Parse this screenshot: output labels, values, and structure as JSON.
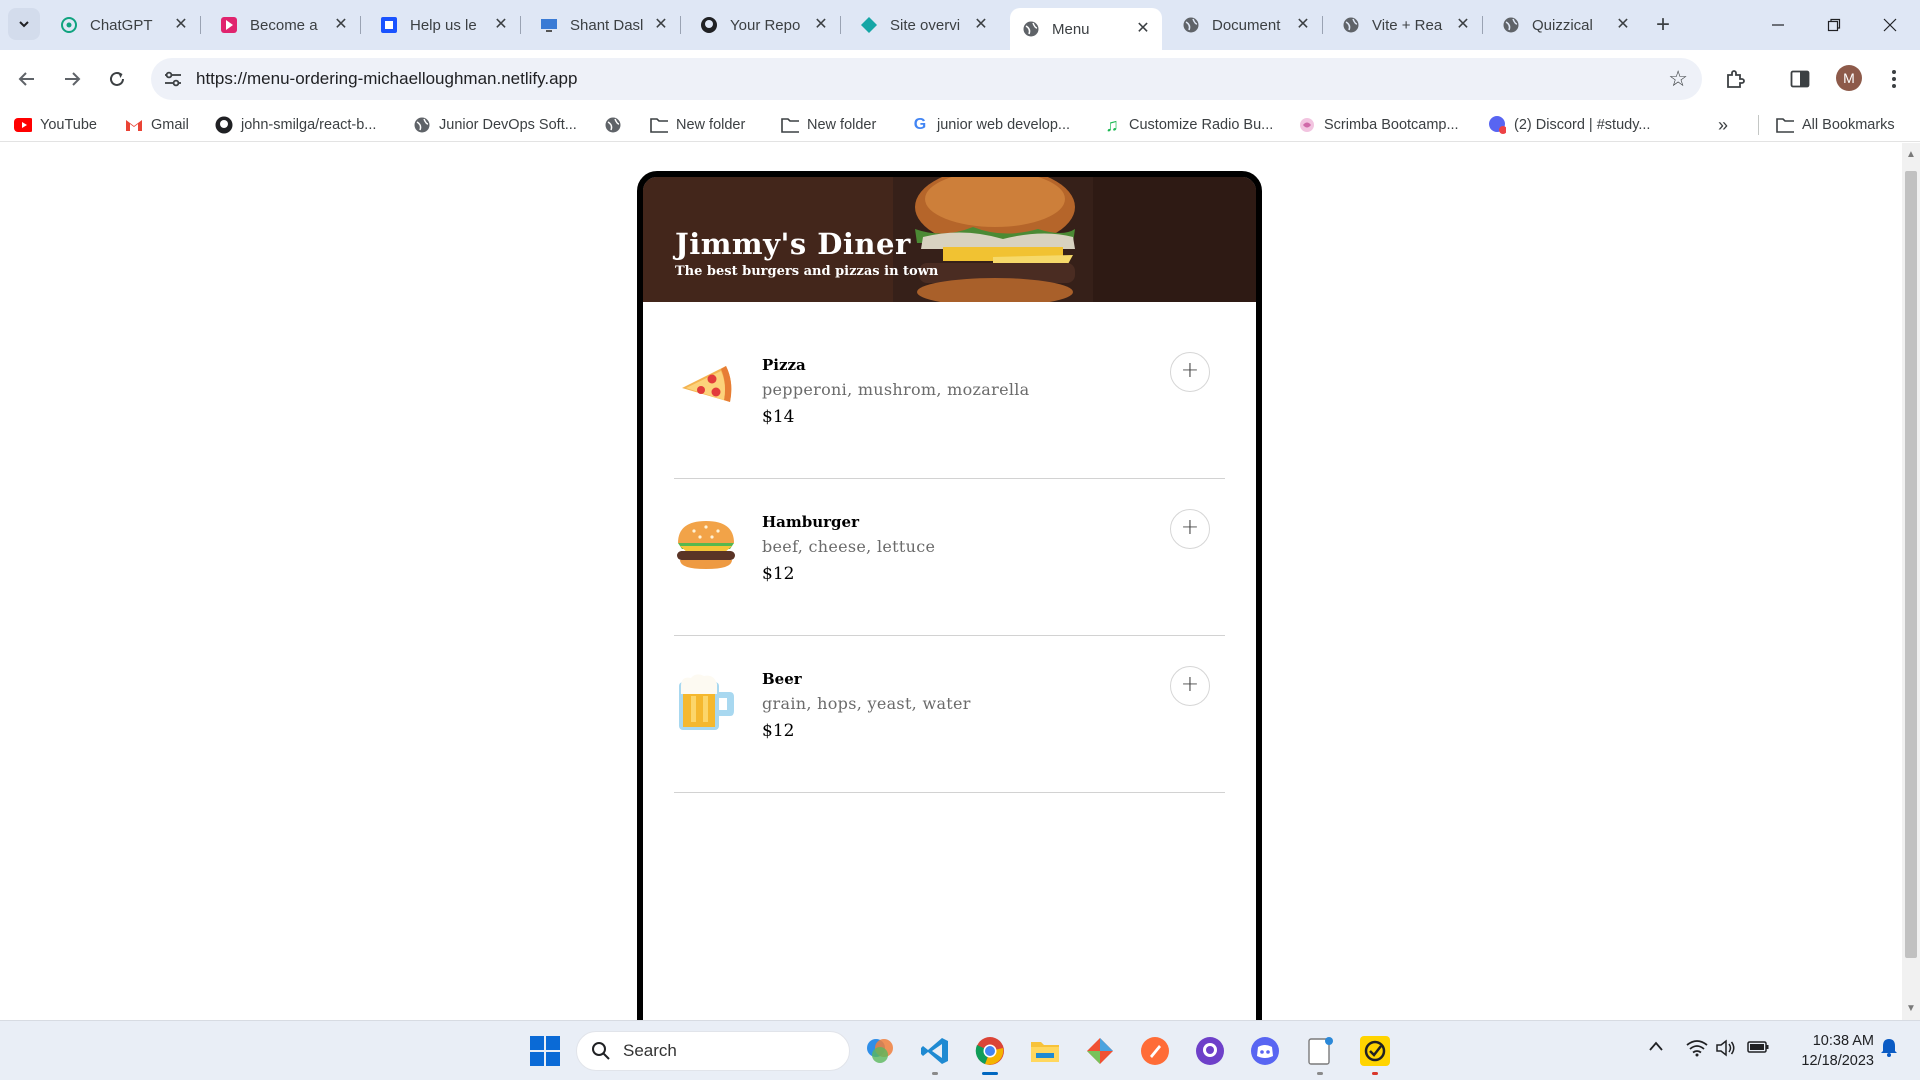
{
  "browser": {
    "tabs": [
      {
        "title": "ChatGPT",
        "icon": "chatgpt-icon",
        "active": false
      },
      {
        "title": "Become a",
        "icon": "bitdegree-icon",
        "active": false
      },
      {
        "title": "Help us le",
        "icon": "help-icon",
        "active": false
      },
      {
        "title": "Shant Dasl",
        "icon": "monitor-icon",
        "active": false
      },
      {
        "title": "Your Repo",
        "icon": "github-icon",
        "active": false
      },
      {
        "title": "Site overvi",
        "icon": "netlify-icon",
        "active": false
      },
      {
        "title": "Menu",
        "icon": "globe-icon",
        "active": true
      },
      {
        "title": "Document",
        "icon": "globe-icon",
        "active": false
      },
      {
        "title": "Vite + Rea",
        "icon": "globe-icon",
        "active": false
      },
      {
        "title": "Quizzical",
        "icon": "globe-icon",
        "active": false
      }
    ],
    "url": "https://menu-ordering-michaelloughman.netlify.app",
    "profile_initial": "M",
    "bookmarks": [
      {
        "label": "YouTube",
        "icon": "youtube-icon"
      },
      {
        "label": "Gmail",
        "icon": "gmail-icon"
      },
      {
        "label": "john-smilga/react-b...",
        "icon": "github-icon"
      },
      {
        "label": "Junior DevOps Soft...",
        "icon": "globe-icon"
      },
      {
        "label": "",
        "icon": "globe-icon"
      },
      {
        "label": "New folder",
        "icon": "folder-icon"
      },
      {
        "label": "New folder",
        "icon": "folder-icon"
      },
      {
        "label": "junior web develop...",
        "icon": "google-icon"
      },
      {
        "label": "Customize Radio Bu...",
        "icon": "music-icon"
      },
      {
        "label": "Scrimba Bootcamp...",
        "icon": "scrimba-icon"
      },
      {
        "label": "(2) Discord | #study...",
        "icon": "discord-icon"
      }
    ],
    "all_bookmarks_label": "All Bookmarks"
  },
  "page": {
    "diner_name": "Jimmy's Diner",
    "tagline": "The best burgers and pizzas in town",
    "menu": [
      {
        "name": "Pizza",
        "ingredients": "pepperoni, mushrom, mozarella",
        "price": "$14",
        "emoji": "pizza-icon"
      },
      {
        "name": "Hamburger",
        "ingredients": "beef, cheese, lettuce",
        "price": "$12",
        "emoji": "hamburger-icon"
      },
      {
        "name": "Beer",
        "ingredients": "grain, hops, yeast, water",
        "price": "$12",
        "emoji": "beer-icon"
      }
    ],
    "add_label": "+"
  },
  "taskbar": {
    "search_placeholder": "Search",
    "time": "10:38 AM",
    "date": "12/18/2023"
  },
  "colors": {
    "accent": "#0067c0",
    "tabstrip": "#dfe7f5",
    "taskbar": "#e9eef6"
  }
}
